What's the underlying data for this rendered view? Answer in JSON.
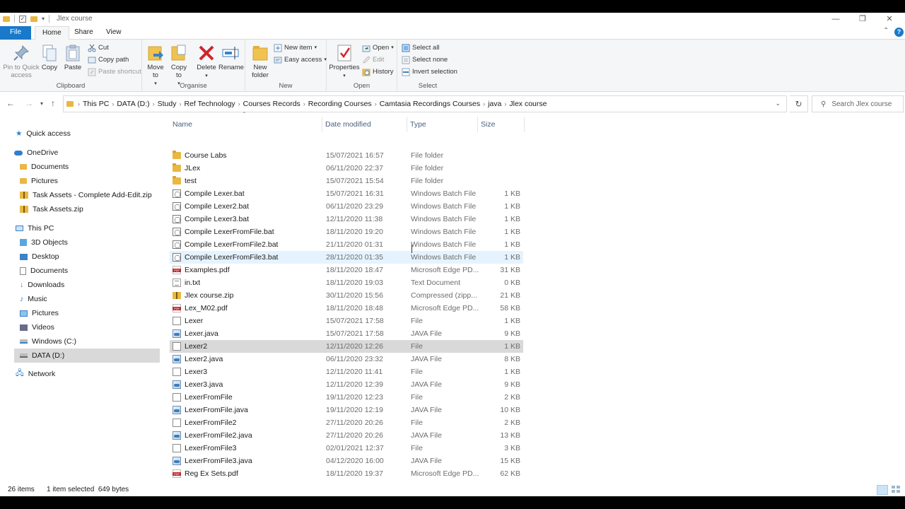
{
  "window": {
    "title": "Jlex course",
    "minimize_glyph": "—",
    "maximize_glyph": "❐",
    "close_glyph": "✕"
  },
  "ribbon_tabs": [
    "File",
    "Home",
    "Share",
    "View"
  ],
  "ribbon": {
    "clipboard": {
      "label": "Clipboard",
      "pin": "Pin to Quick access",
      "copy": "Copy",
      "paste": "Paste",
      "cut": "Cut",
      "copy_path": "Copy path",
      "paste_shortcut": "Paste shortcut"
    },
    "organise": {
      "label": "Organise",
      "move_to": "Move to",
      "copy_to": "Copy to",
      "delete": "Delete",
      "rename": "Rename"
    },
    "new": {
      "label": "New",
      "new_folder": "New folder",
      "new_item": "New item",
      "easy_access": "Easy access"
    },
    "open": {
      "label": "Open",
      "properties": "Properties",
      "open": "Open",
      "edit": "Edit",
      "history": "History"
    },
    "select": {
      "label": "Select",
      "select_all": "Select all",
      "select_none": "Select none",
      "invert_selection": "Invert selection"
    }
  },
  "breadcrumb": [
    "This PC",
    "DATA (D:)",
    "Study",
    "Ref Technology",
    "Courses Records",
    "Recording Courses",
    "Camtasia Recordings Courses",
    "java",
    "Jlex course"
  ],
  "search": {
    "placeholder": "Search Jlex course"
  },
  "nav_pane": {
    "quick_access": "Quick access",
    "onedrive": "OneDrive",
    "onedrive_items": [
      "Documents",
      "Pictures",
      "Task Assets - Complete Add-Edit.zip",
      "Task Assets.zip"
    ],
    "this_pc": "This PC",
    "this_pc_items": [
      "3D Objects",
      "Desktop",
      "Documents",
      "Downloads",
      "Music",
      "Pictures",
      "Videos",
      "Windows (C:)",
      "DATA (D:)"
    ],
    "network": "Network"
  },
  "columns": {
    "name": "Name",
    "date": "Date modified",
    "type": "Type",
    "size": "Size"
  },
  "files": [
    {
      "name": "Course Labs",
      "date": "15/07/2021 16:57",
      "type": "File folder",
      "size": "",
      "icon": "folder"
    },
    {
      "name": "JLex",
      "date": "06/11/2020 22:37",
      "type": "File folder",
      "size": "",
      "icon": "folder"
    },
    {
      "name": "test",
      "date": "15/07/2021 15:54",
      "type": "File folder",
      "size": "",
      "icon": "folder"
    },
    {
      "name": "Compile Lexer.bat",
      "date": "15/07/2021 16:31",
      "type": "Windows Batch File",
      "size": "1 KB",
      "icon": "bat"
    },
    {
      "name": "Compile Lexer2.bat",
      "date": "06/11/2020 23:29",
      "type": "Windows Batch File",
      "size": "1 KB",
      "icon": "bat"
    },
    {
      "name": "Compile Lexer3.bat",
      "date": "12/11/2020 11:38",
      "type": "Windows Batch File",
      "size": "1 KB",
      "icon": "bat"
    },
    {
      "name": "Compile LexerFromFile.bat",
      "date": "18/11/2020 19:20",
      "type": "Windows Batch File",
      "size": "1 KB",
      "icon": "bat"
    },
    {
      "name": "Compile LexerFromFile2.bat",
      "date": "21/11/2020 01:31",
      "type": "Windows Batch File",
      "size": "1 KB",
      "icon": "bat"
    },
    {
      "name": "Compile LexerFromFile3.bat",
      "date": "28/11/2020 01:35",
      "type": "Windows Batch File",
      "size": "1 KB",
      "icon": "bat"
    },
    {
      "name": "Examples.pdf",
      "date": "18/11/2020 18:47",
      "type": "Microsoft Edge PD...",
      "size": "31 KB",
      "icon": "pdf"
    },
    {
      "name": "in.txt",
      "date": "18/11/2020 19:03",
      "type": "Text Document",
      "size": "0 KB",
      "icon": "txt"
    },
    {
      "name": "Jlex course.zip",
      "date": "30/11/2020 15:56",
      "type": "Compressed (zipp...",
      "size": "21 KB",
      "icon": "zip"
    },
    {
      "name": "Lex_M02.pdf",
      "date": "18/11/2020 18:48",
      "type": "Microsoft Edge PD...",
      "size": "58 KB",
      "icon": "pdf"
    },
    {
      "name": "Lexer",
      "date": "15/07/2021 17:58",
      "type": "File",
      "size": "1 KB",
      "icon": "blank"
    },
    {
      "name": "Lexer.java",
      "date": "15/07/2021 17:58",
      "type": "JAVA File",
      "size": "9 KB",
      "icon": "java"
    },
    {
      "name": "Lexer2",
      "date": "12/11/2020 12:26",
      "type": "File",
      "size": "1 KB",
      "icon": "blank"
    },
    {
      "name": "Lexer2.java",
      "date": "06/11/2020 23:32",
      "type": "JAVA File",
      "size": "8 KB",
      "icon": "java"
    },
    {
      "name": "Lexer3",
      "date": "12/11/2020 11:41",
      "type": "File",
      "size": "1 KB",
      "icon": "blank"
    },
    {
      "name": "Lexer3.java",
      "date": "12/11/2020 12:39",
      "type": "JAVA File",
      "size": "9 KB",
      "icon": "java"
    },
    {
      "name": "LexerFromFile",
      "date": "19/11/2020 12:23",
      "type": "File",
      "size": "2 KB",
      "icon": "blank"
    },
    {
      "name": "LexerFromFile.java",
      "date": "19/11/2020 12:19",
      "type": "JAVA File",
      "size": "10 KB",
      "icon": "java"
    },
    {
      "name": "LexerFromFile2",
      "date": "27/11/2020 20:26",
      "type": "File",
      "size": "2 KB",
      "icon": "blank"
    },
    {
      "name": "LexerFromFile2.java",
      "date": "27/11/2020 20:26",
      "type": "JAVA File",
      "size": "13 KB",
      "icon": "java"
    },
    {
      "name": "LexerFromFile3",
      "date": "02/01/2021 12:37",
      "type": "File",
      "size": "3 KB",
      "icon": "blank"
    },
    {
      "name": "LexerFromFile3.java",
      "date": "04/12/2020 16:00",
      "type": "JAVA File",
      "size": "15 KB",
      "icon": "java"
    },
    {
      "name": "Reg Ex Sets.pdf",
      "date": "18/11/2020 19:37",
      "type": "Microsoft Edge PD...",
      "size": "62 KB",
      "icon": "pdf"
    }
  ],
  "selected_file": "Lexer2",
  "hovered_file": "Compile LexerFromFile3.bat",
  "status": {
    "items": "26 items",
    "selection": "1 item selected  649 bytes"
  },
  "colors": {
    "accent": "#1979ca",
    "selection": "#d9d9d9",
    "hover": "#e5f3ff",
    "folder": "#e9b742"
  }
}
